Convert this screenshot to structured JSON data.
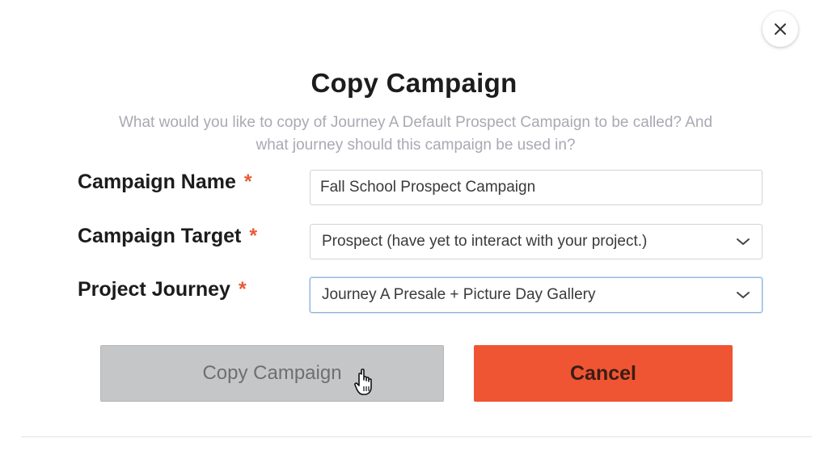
{
  "dialog": {
    "title": "Copy Campaign",
    "subtitle": "What would you like to copy of Journey A Default Prospect Campaign to be called? And what journey should this campaign be used in?",
    "close_icon": "close-icon"
  },
  "form": {
    "campaign_name": {
      "label": "Campaign Name",
      "required_mark": "*",
      "value": "Fall School Prospect Campaign"
    },
    "campaign_target": {
      "label": "Campaign Target",
      "required_mark": "*",
      "selected": "Prospect (have yet to interact with your project.)",
      "icon": "chevron-down-icon"
    },
    "project_journey": {
      "label": "Project Journey",
      "required_mark": "*",
      "selected": "Journey A Presale + Picture Day Gallery",
      "icon": "chevron-down-icon"
    }
  },
  "actions": {
    "copy_label": "Copy Campaign",
    "cancel_label": "Cancel"
  },
  "colors": {
    "accent": "#ef5533",
    "required": "#e85a38",
    "disabled_button": "#c5c6c8",
    "subtitle_text": "#a9a9b3"
  }
}
